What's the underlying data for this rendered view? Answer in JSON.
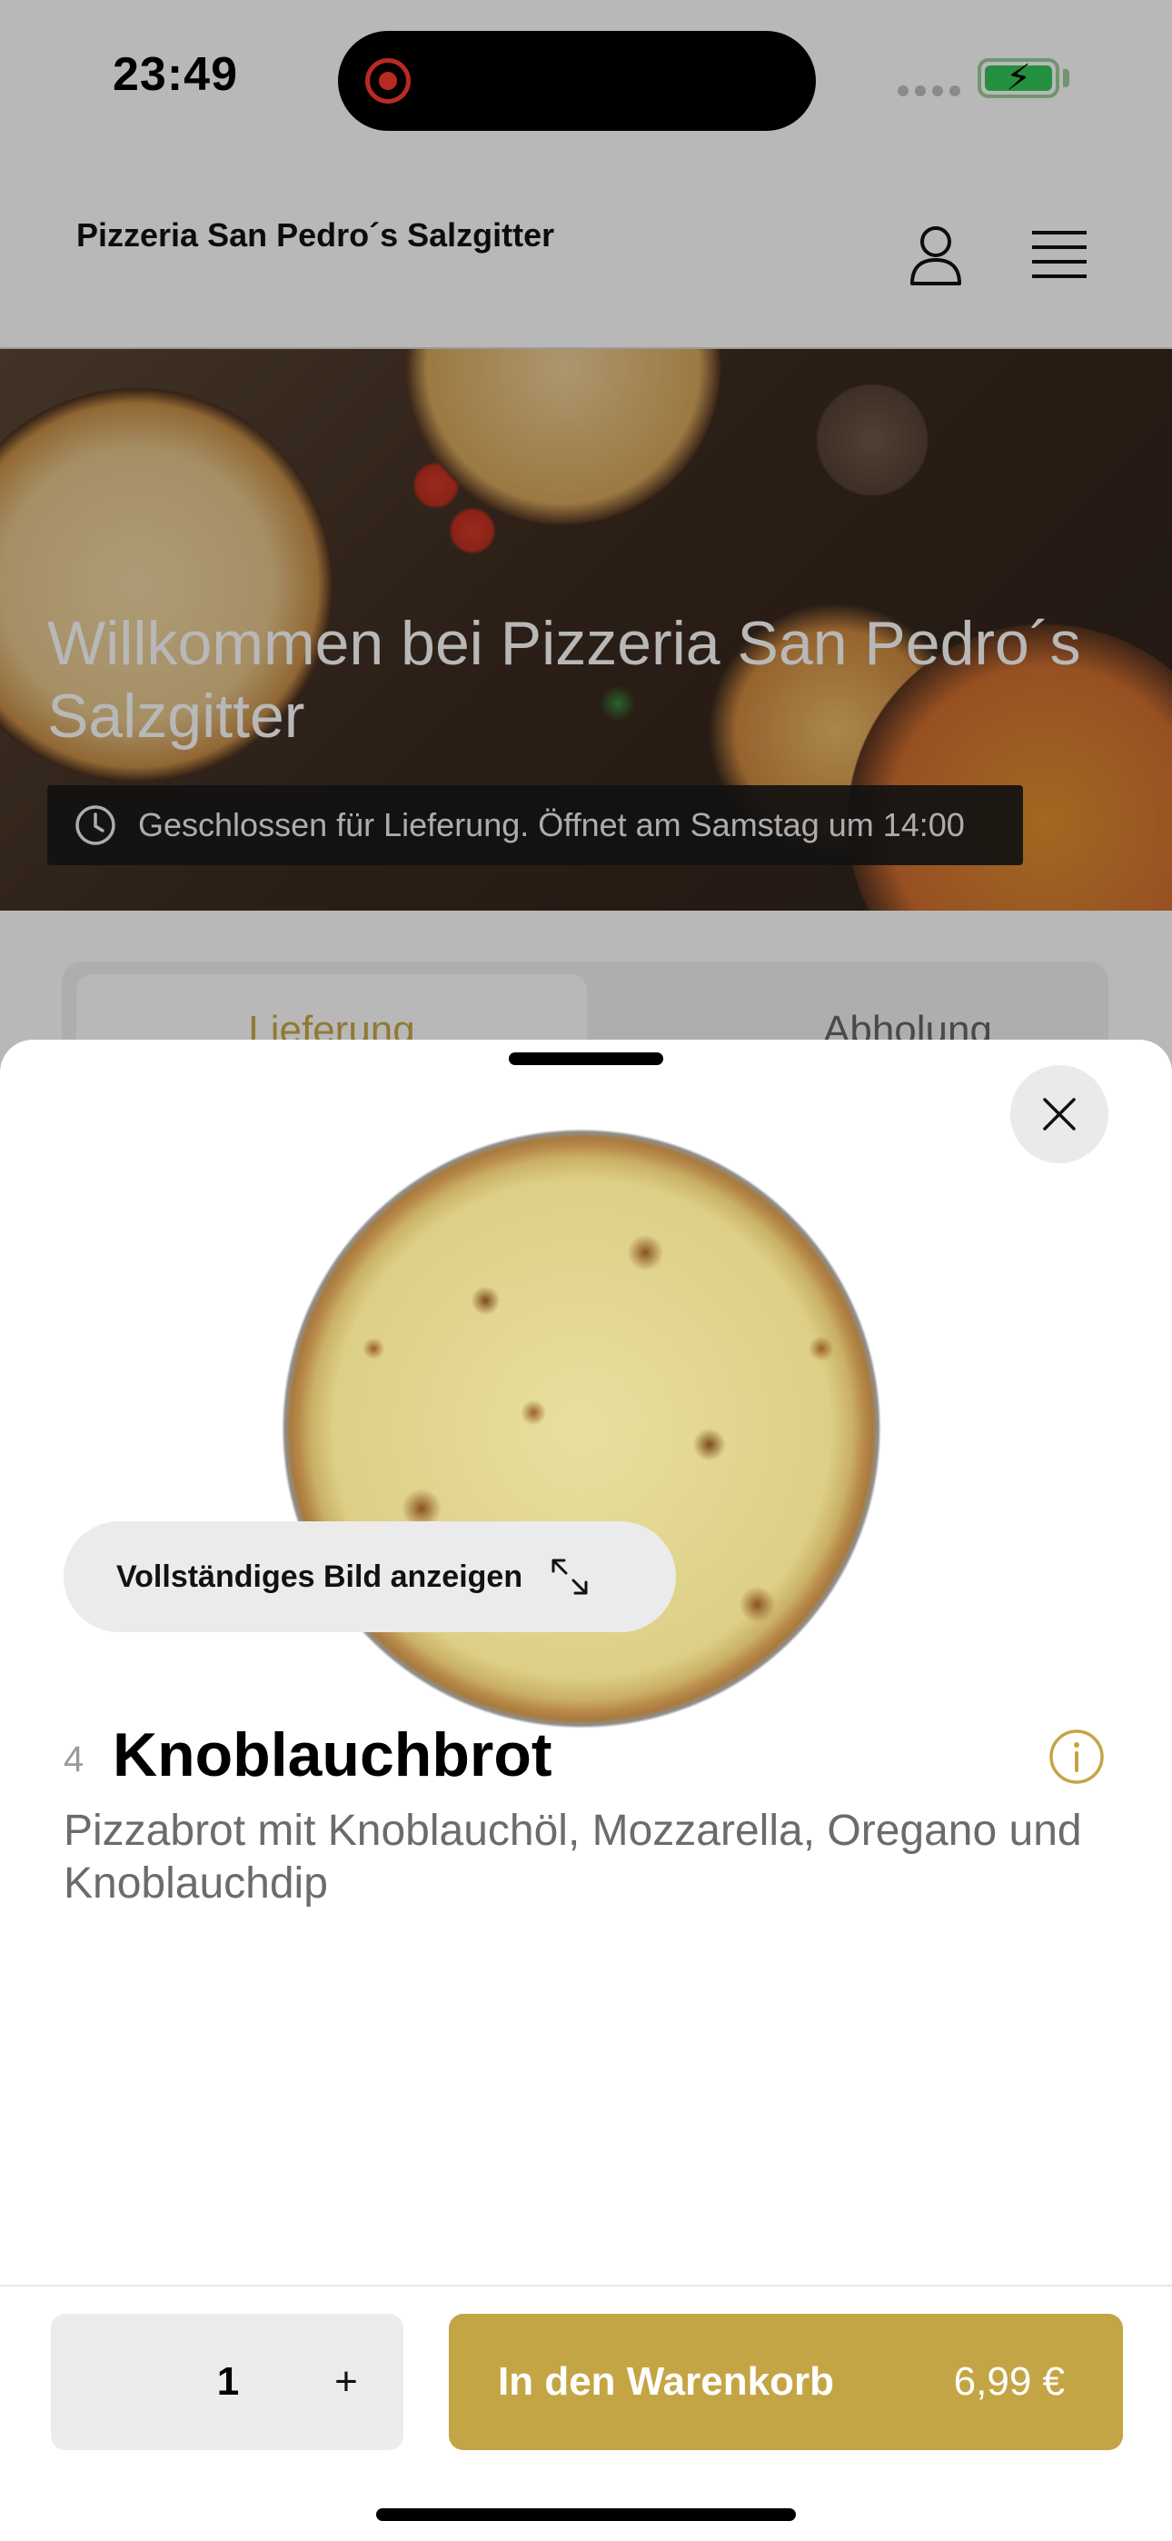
{
  "status_bar": {
    "time": "23:49"
  },
  "header": {
    "restaurant_name": "Pizzeria San Pedro´s Salzgitter",
    "profile_icon": "person-icon",
    "menu_icon": "hamburger-menu-icon"
  },
  "hero": {
    "title": "Willkommen bei Pizzeria San Pedro´s Salzgitter",
    "status_text": "Geschlossen für Lieferung. Öffnet am Samstag um 14:00"
  },
  "order_mode": {
    "delivery": "Lieferung",
    "pickup": "Abholung"
  },
  "product_sheet": {
    "full_image_label": "Vollständiges Bild anzeigen",
    "number": "4",
    "name": "Knoblauchbrot",
    "description": "Pizzabrot mit Knoblauchöl, Mozzarella, Oregano und Knoblauchdip",
    "quantity": "1",
    "plus_label": "+",
    "add_to_cart_label": "In den Warenkorb",
    "price": "6,99 €"
  },
  "colors": {
    "accent_gold": "#c4a545",
    "recording_red": "#ff3b30",
    "battery_green": "#34c759"
  }
}
